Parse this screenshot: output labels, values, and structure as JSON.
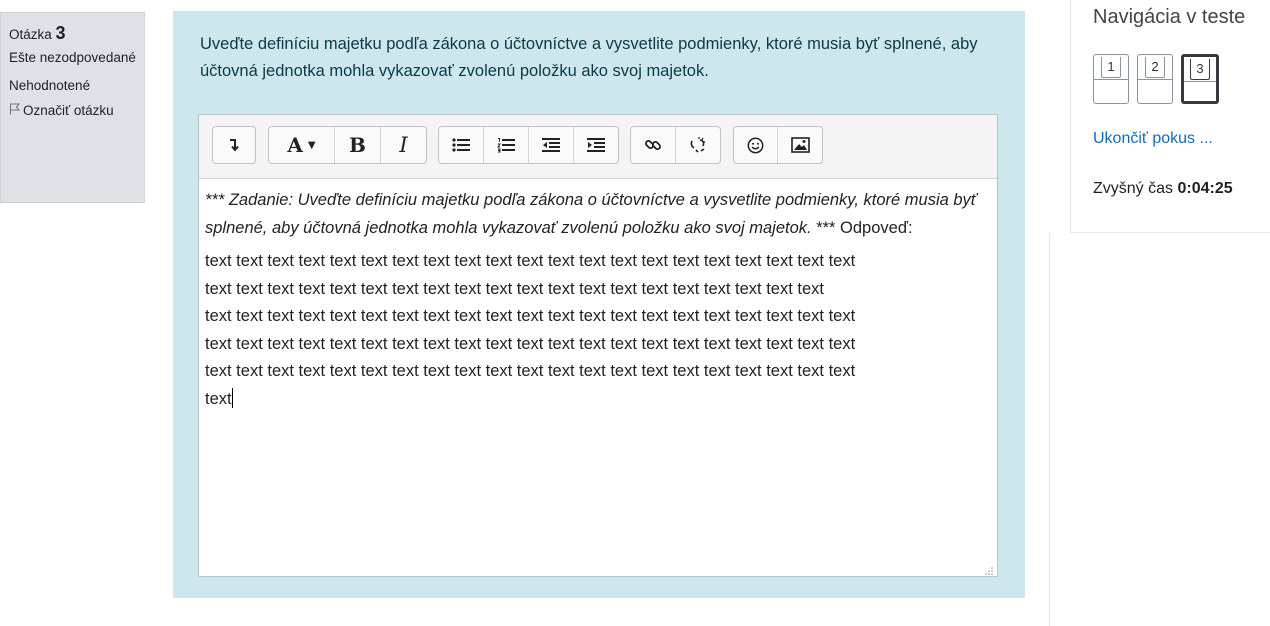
{
  "question_info": {
    "label": "Otázka",
    "number": "3",
    "state": "Ešte nezodpovedané",
    "grade": "Nehodnotené",
    "flag_label": "Označiť otázku"
  },
  "question": {
    "text": "Uveďte definíciu majetku podľa zákona o účtovníctve a vysvetlite podmienky, ktoré musia byť splnené, aby účtovná jednotka mohla vykazovať zvolenú položku ako svoj majetok."
  },
  "editor": {
    "toolbar": {
      "groups": [
        [
          "show-more"
        ],
        [
          "font-size",
          "bold",
          "italic"
        ],
        [
          "unordered-list",
          "ordered-list",
          "outdent",
          "indent"
        ],
        [
          "link",
          "unlink"
        ],
        [
          "emoji",
          "image"
        ]
      ],
      "font_size_label": "A",
      "bold_label": "B",
      "italic_label": "I"
    },
    "prompt_italic": "*** Zadanie: Uveďte definíciu majetku podľa zákona o účtovníctve a vysvetlite podmienky, ktoré musia byť splnené, aby účtovná jednotka mohla vykazovať zvolenú položku ako svoj majetok.",
    "prompt_suffix": " *** Odpoveď:",
    "answer_lines": [
      "text text text text text text text text text text text text text text text text text text text text text",
      "text text text text text text text text text text text text text text text text text text text text",
      "text text text text text text text text text text text text text text text text text text text text text",
      "text text text text text text text text text text text text text text text text text text text text text",
      "text text text text text text text text text text text text text text text text text text text text text",
      "text"
    ]
  },
  "navigation": {
    "title": "Navigácia v teste",
    "buttons": [
      {
        "label": "1",
        "current": false
      },
      {
        "label": "2",
        "current": false
      },
      {
        "label": "3",
        "current": true
      }
    ],
    "finish_link": "Ukončiť pokus ...",
    "timer_label": "Zvyšný čas",
    "timer_value": "0:04:25"
  }
}
